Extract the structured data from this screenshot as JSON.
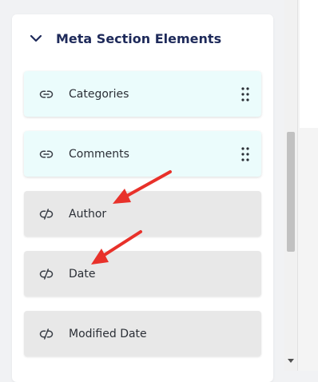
{
  "section": {
    "title": "Meta Section Elements",
    "expanded": true
  },
  "items": [
    {
      "label": "Categories",
      "state": "enabled",
      "icon": "link-icon",
      "draggable": true
    },
    {
      "label": "Comments",
      "state": "enabled",
      "icon": "link-icon",
      "draggable": true
    },
    {
      "label": "Author",
      "state": "disabled",
      "icon": "unlink-icon",
      "draggable": false
    },
    {
      "label": "Date",
      "state": "disabled",
      "icon": "unlink-icon",
      "draggable": false
    },
    {
      "label": "Modified Date",
      "state": "disabled",
      "icon": "unlink-icon",
      "draggable": false
    }
  ],
  "colors": {
    "enabled_bg": "#ebfcfc",
    "disabled_bg": "#e8e8e8",
    "title": "#1e2a5a",
    "annotation_arrow": "#e8312a"
  }
}
